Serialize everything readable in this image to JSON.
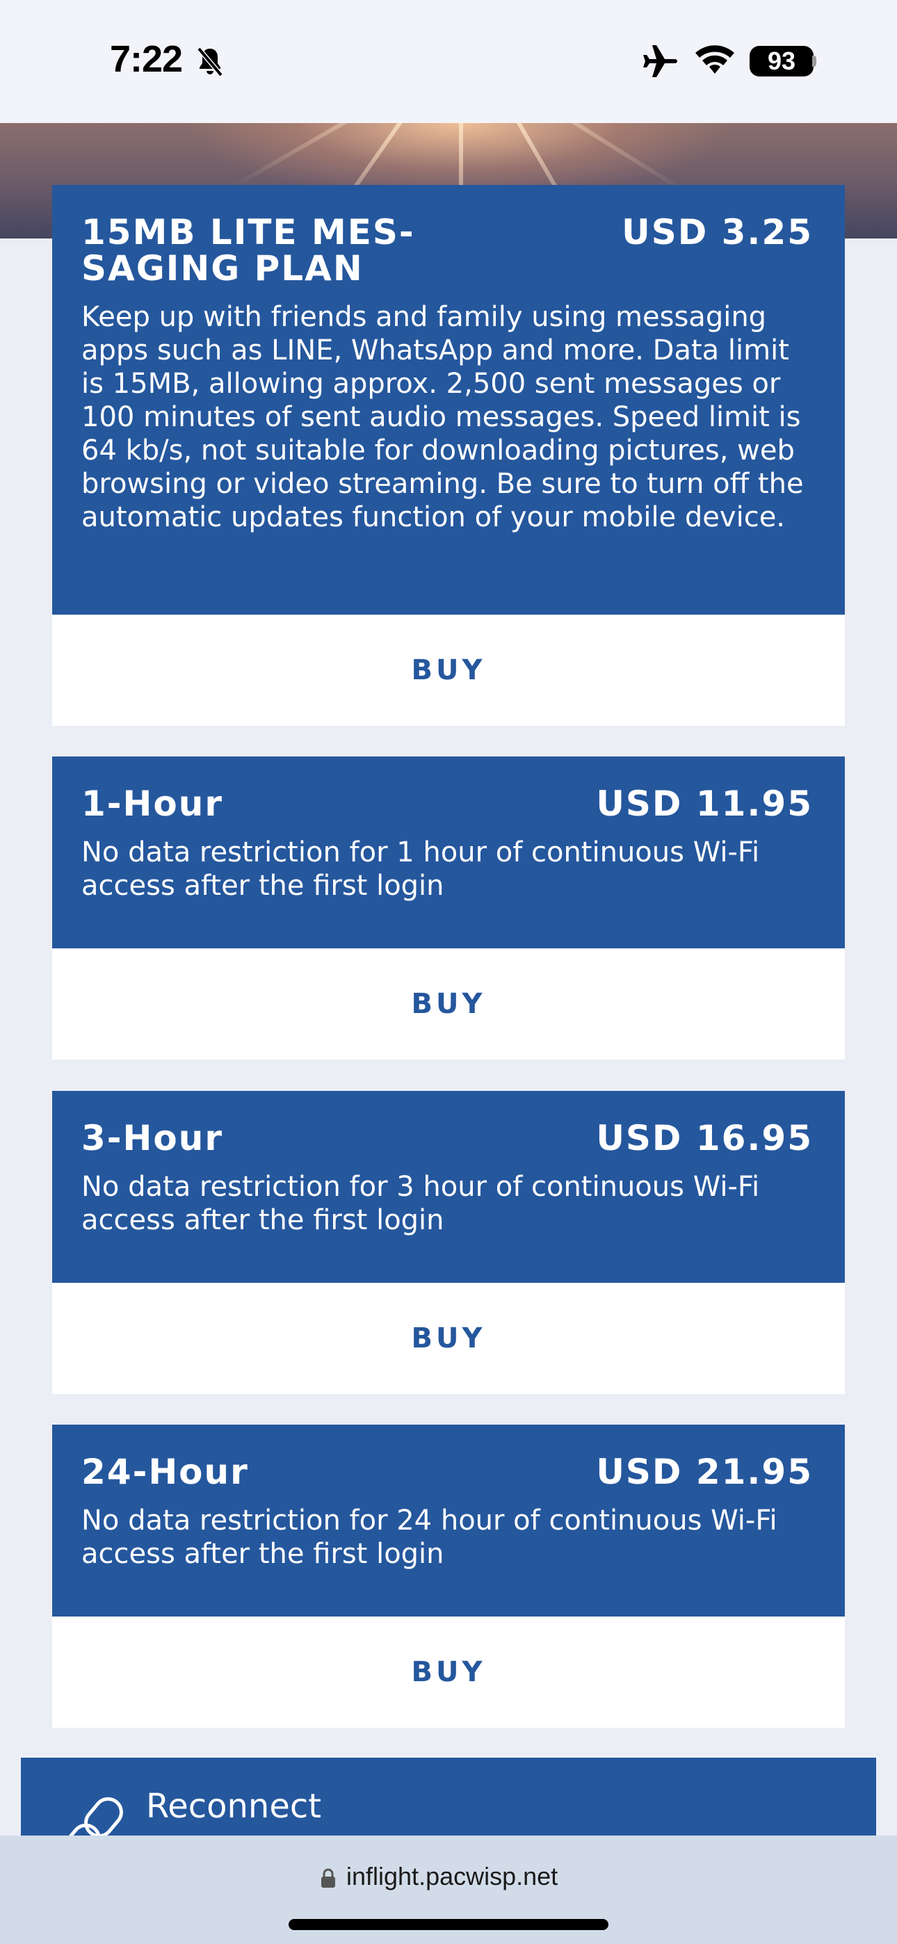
{
  "status_bar": {
    "time": "7:22",
    "battery": "93",
    "icons": [
      "bell-slash-icon",
      "airplane-icon",
      "wifi-icon",
      "battery-icon"
    ]
  },
  "plans": [
    {
      "title": "15MB LITE MES-SAGING PLAN",
      "price": "USD 3.25",
      "description": "Keep up with friends and family using messaging apps such as LINE, WhatsApp and more. Data limit is 15MB, allowing approx. 2,500 sent messages or 100 minutes of sent audio messages. Speed limit is 64 kb/s, not suitable for downloading pictures, web browsing or video streaming. Be sure to turn off the automatic updates function of your mobile device.",
      "buy_label": "BUY"
    },
    {
      "title": "1-Hour",
      "price": "USD 11.95",
      "description": "No data restriction for 1 hour of continuous Wi-Fi access after the first login",
      "buy_label": "BUY"
    },
    {
      "title": "3-Hour",
      "price": "USD 16.95",
      "description": "No data restriction for 3 hour of continuous Wi-Fi access after the first login",
      "buy_label": "BUY"
    },
    {
      "title": "24-Hour",
      "price": "USD 21.95",
      "description": "No data restriction for 24 hour of continuous Wi-Fi access after the first login",
      "buy_label": "BUY"
    }
  ],
  "reconnect": {
    "label": "Reconnect",
    "icon": "link-icon"
  },
  "browser": {
    "url": "inflight.pacwisp.net"
  },
  "colors": {
    "card_blue": "#25579d",
    "page_bg": "#eceef6",
    "url_bar_bg": "#d2dce9"
  }
}
